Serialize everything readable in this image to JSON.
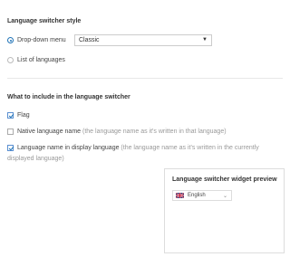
{
  "switcher_style": {
    "heading": "Language switcher style",
    "dropdown_label": "Drop-down menu",
    "dropdown_selected": "Classic",
    "list_label": "List of languages"
  },
  "include": {
    "heading": "What to include in the language switcher",
    "flag_label": "Flag",
    "native_label": "Native language name",
    "native_hint": " (the language name as it's written in that language)",
    "display_label": "Language name in display language",
    "display_hint": " (the language name as it's written in the currently",
    "display_hint_cont": "displayed language)"
  },
  "preview": {
    "title": "Language switcher widget preview",
    "selected_language": "English",
    "flag_icon": "uk-flag-icon"
  },
  "colors": {
    "accent": "#1f73b7"
  }
}
